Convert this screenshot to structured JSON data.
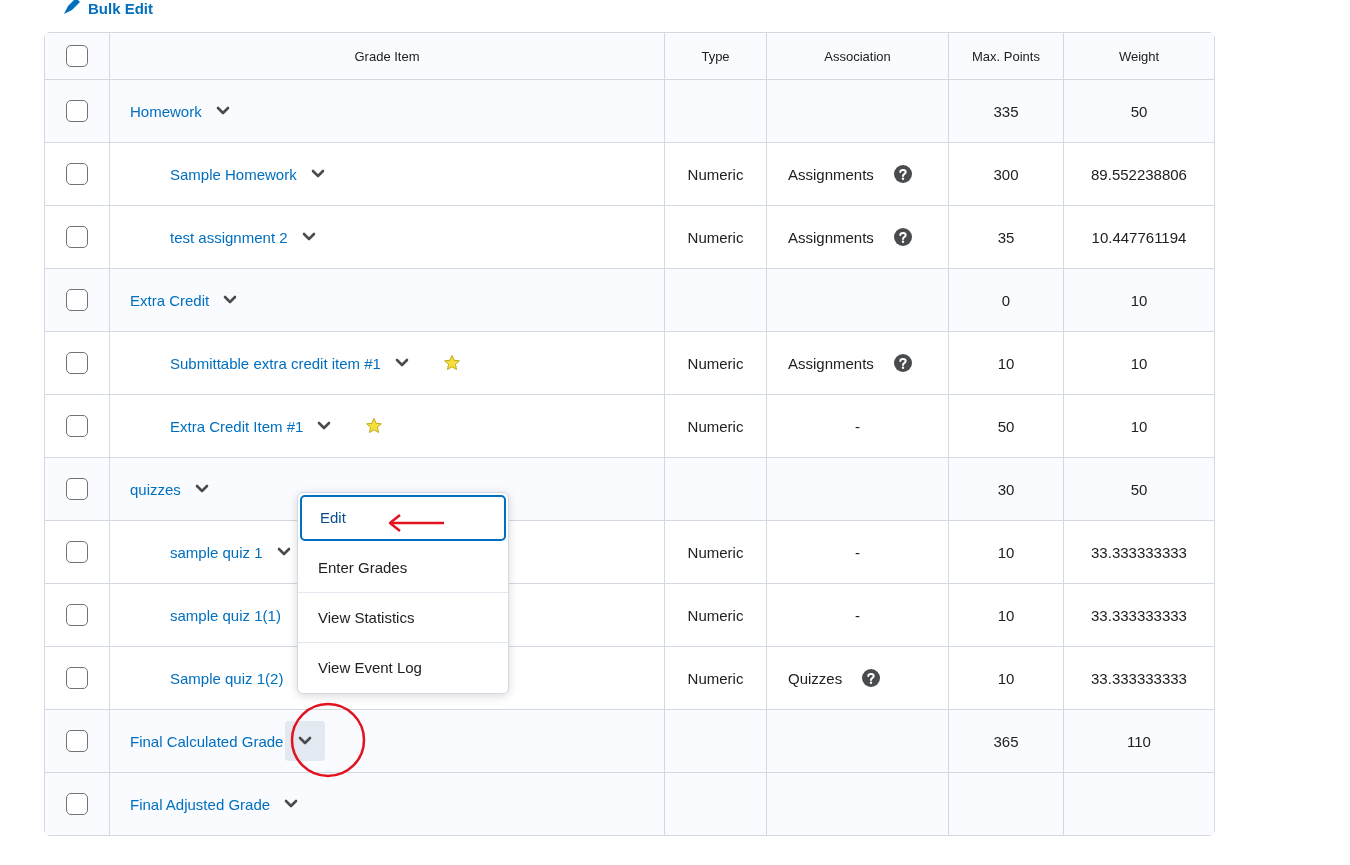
{
  "toolbar": {
    "bulk_edit": "Bulk Edit"
  },
  "table": {
    "header_checked": false,
    "columns": [
      "Grade Item",
      "Type",
      "Association",
      "Max. Points",
      "Weight"
    ],
    "rows": [
      {
        "name": "Homework",
        "checked": false,
        "type": "",
        "association": "",
        "help": false,
        "bonus": false,
        "active": false,
        "max_points": "335",
        "weight": "50",
        "children": [
          {
            "name": "Sample Homework",
            "checked": false,
            "type": "Numeric",
            "association": "Assignments",
            "help": true,
            "bonus": false,
            "active": false,
            "max_points": "300",
            "weight": "89.552238806"
          },
          {
            "name": "test assignment 2",
            "checked": false,
            "type": "Numeric",
            "association": "Assignments",
            "help": true,
            "bonus": false,
            "active": false,
            "max_points": "35",
            "weight": "10.447761194"
          }
        ]
      },
      {
        "name": "Extra Credit",
        "checked": false,
        "type": "",
        "association": "",
        "help": false,
        "bonus": false,
        "active": false,
        "max_points": "0",
        "weight": "10",
        "children": [
          {
            "name": "Submittable extra credit item #1",
            "checked": false,
            "type": "Numeric",
            "association": "Assignments",
            "help": true,
            "bonus": true,
            "active": false,
            "max_points": "10",
            "weight": "10"
          },
          {
            "name": "Extra Credit Item #1",
            "checked": false,
            "type": "Numeric",
            "association": "-",
            "help": false,
            "bonus": true,
            "active": false,
            "max_points": "50",
            "weight": "10"
          }
        ]
      },
      {
        "name": "quizzes",
        "checked": false,
        "type": "",
        "association": "",
        "help": false,
        "bonus": false,
        "active": false,
        "max_points": "30",
        "weight": "50",
        "children": [
          {
            "name": "sample quiz 1",
            "checked": false,
            "type": "Numeric",
            "association": "-",
            "help": false,
            "bonus": false,
            "active": false,
            "max_points": "10",
            "weight": "33.333333333"
          },
          {
            "name": "sample quiz 1(1)",
            "checked": false,
            "type": "Numeric",
            "association": "-",
            "help": false,
            "bonus": false,
            "chevron_hidden": true,
            "max_points": "10",
            "weight": "33.333333333"
          },
          {
            "name": "Sample quiz 1(2)",
            "checked": false,
            "type": "Numeric",
            "association": "Quizzes",
            "help": true,
            "bonus": false,
            "chevron_hidden": true,
            "max_points": "10",
            "weight": "33.333333333"
          }
        ]
      },
      {
        "name": "Final Calculated Grade",
        "checked": false,
        "type": "",
        "association": "",
        "help": false,
        "bonus": false,
        "active": true,
        "max_points": "365",
        "weight": "110"
      },
      {
        "name": "Final Adjusted Grade",
        "checked": false,
        "type": "",
        "association": "",
        "help": false,
        "bonus": false,
        "active": false,
        "max_points": "",
        "weight": ""
      }
    ]
  },
  "context_menu": {
    "items": [
      {
        "label": "Edit",
        "selected": true
      },
      {
        "label": "Enter Grades",
        "selected": false
      },
      {
        "label": "View Statistics",
        "selected": false
      },
      {
        "label": "View Event Log",
        "selected": false
      }
    ]
  }
}
